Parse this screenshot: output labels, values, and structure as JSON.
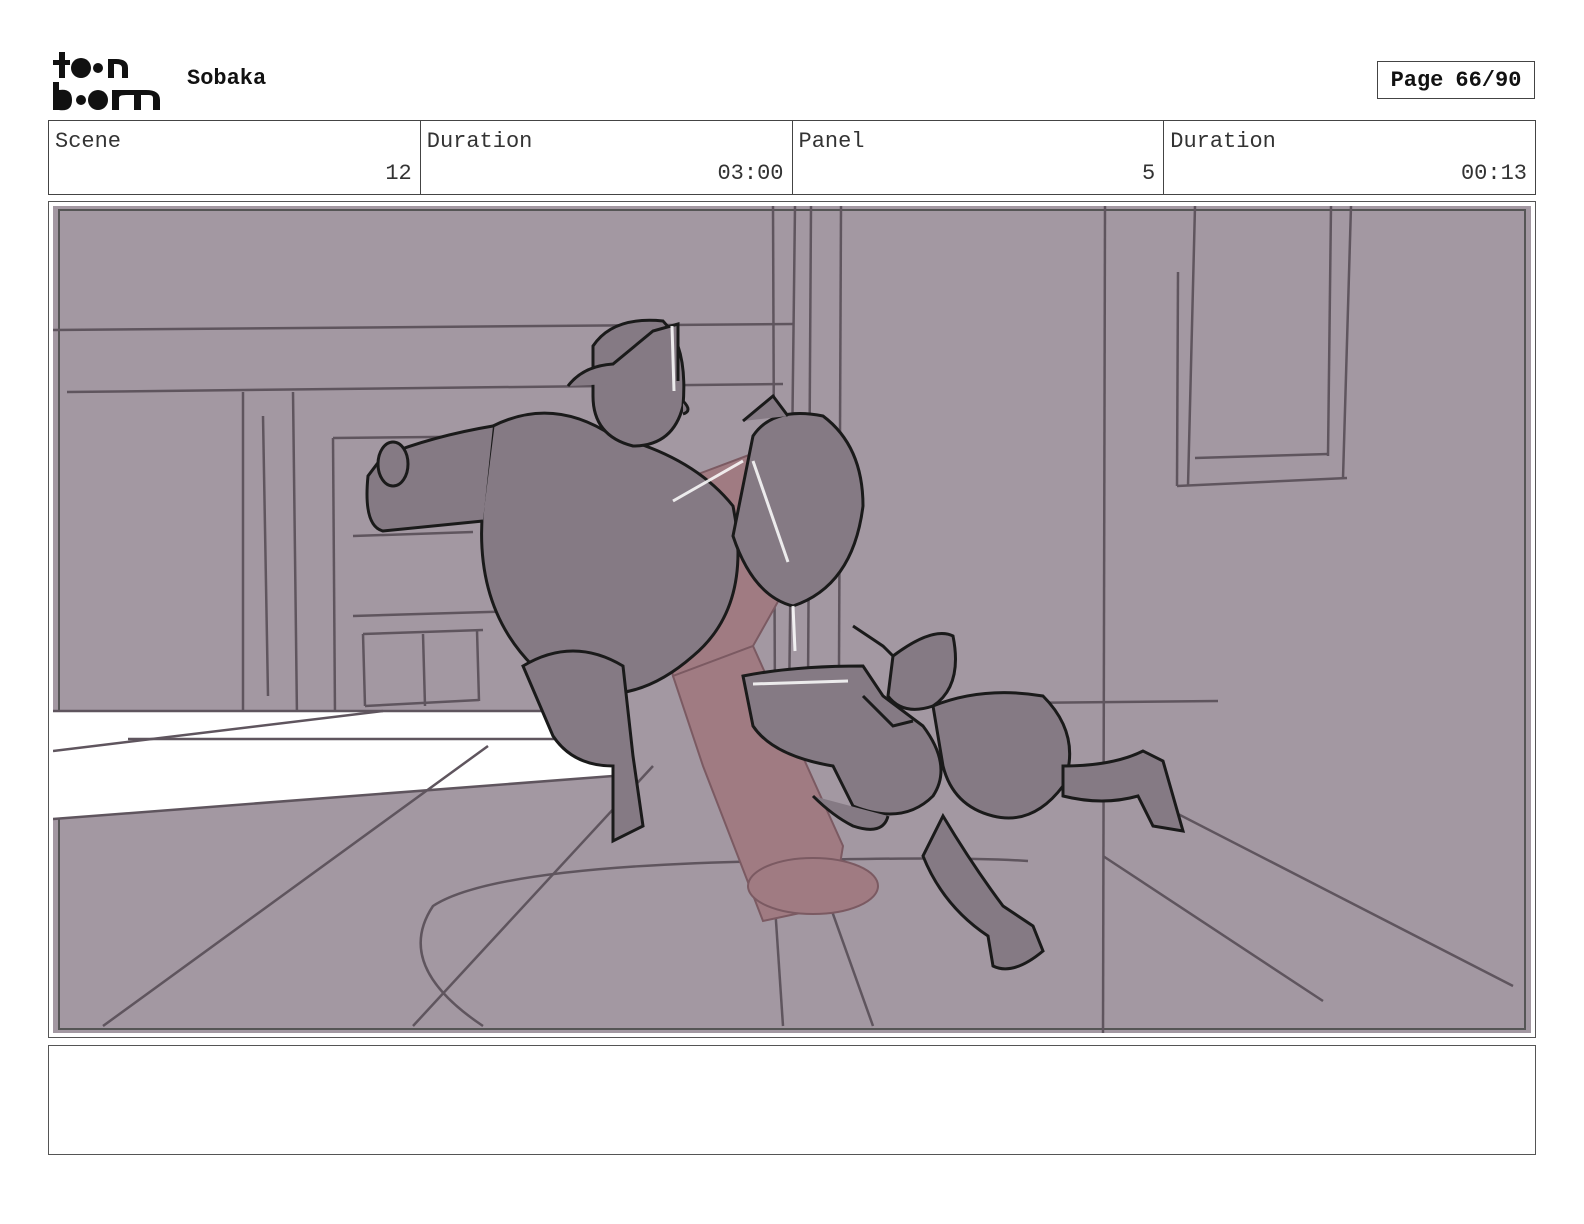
{
  "header": {
    "logo_text": "toon boom",
    "project_title": "Sobaka",
    "page_label": "Page",
    "page_number": "66/90"
  },
  "info": {
    "scene_label": "Scene",
    "scene_value": "12",
    "scene_duration_label": "Duration",
    "scene_duration_value": "03:00",
    "panel_label": "Panel",
    "panel_value": "5",
    "panel_duration_label": "Duration",
    "panel_duration_value": "00:13"
  },
  "panel": {
    "background_color": "#a398a2",
    "character_color": "#857a84",
    "prop_color": "#a07b82",
    "line_color": "#1a1a1a"
  },
  "notes": {
    "text": ""
  }
}
